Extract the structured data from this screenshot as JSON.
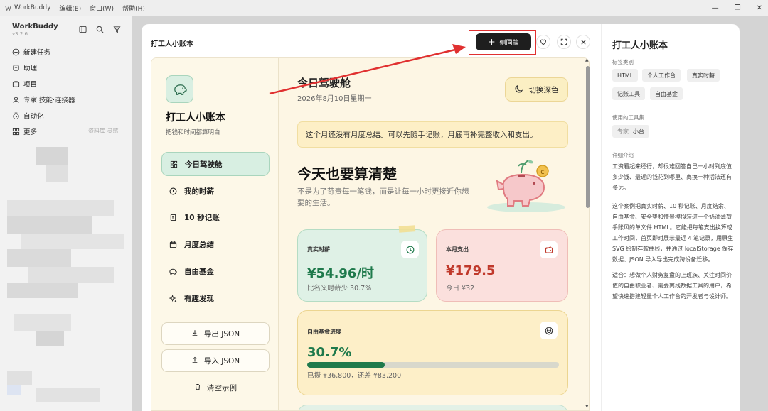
{
  "menubar": {
    "app_name": "WorkBuddy",
    "menus": [
      "编辑(E)",
      "窗口(W)",
      "帮助(H)"
    ]
  },
  "sidebar": {
    "title": "WorkBuddy",
    "version": "v3.2.6",
    "items": [
      {
        "label": "新建任务",
        "icon": "new-task-icon"
      },
      {
        "label": "助理",
        "icon": "assistant-icon"
      },
      {
        "label": "项目",
        "icon": "project-icon"
      },
      {
        "label": "专家·技能·连接器",
        "icon": "expert-icon"
      },
      {
        "label": "自动化",
        "icon": "automation-icon"
      },
      {
        "label": "更多",
        "icon": "more-icon"
      }
    ],
    "more_extra": "资料库 灵感"
  },
  "main": {
    "doc_title": "打工人小账本",
    "side_button_label": "侧同款"
  },
  "preview": {
    "app_title": "打工人小账本",
    "app_subtitle": "把钱和时间都算明白",
    "nav_items": [
      "今日驾驶舱",
      "我的时薪",
      "10 秒记账",
      "月度总结",
      "自由基金",
      "有趣发现"
    ],
    "export_label": "导出 JSON",
    "import_label": "导入 JSON",
    "clear_label": "清空示例",
    "page_title": "今日驾驶舱",
    "date": "2026年8月10日星期一",
    "theme_button": "切换深色",
    "notice": "这个月还没有月度总结。可以先随手记账，月底再补完整收入和支出。",
    "hero_title": "今天也要算清楚",
    "hero_subtitle": "不是为了苛责每一笔钱，而是让每一小时更接近你想要的生活。",
    "cards": {
      "wage": {
        "label": "真实时薪",
        "value": "¥54.96/时",
        "sub": "比名义时薪少 30.7%"
      },
      "expense": {
        "label": "本月支出",
        "value": "¥179.5",
        "sub": "今日 ¥32"
      },
      "fund": {
        "label": "自由基金进度",
        "value": "30.7%",
        "progress": 0.307,
        "sub": "已攒 ¥36,800，还差 ¥83,200"
      }
    }
  },
  "right_panel": {
    "title": "打工人小账本",
    "tags_label": "标签类别",
    "tags": [
      "HTML",
      "个人工作台",
      "真实时薪",
      "记账工具",
      "自由基金"
    ],
    "tools_label": "使用的工具集",
    "tool_prefix": "专家",
    "tool_name": "小台",
    "intro_label": "详细介绍",
    "intro_p1": "工资看起来还行，却很难回答自己一小时到底值多少钱、最近的钱花到哪里、离换一种活法还有多远。",
    "intro_p2": "这个案例把真实时薪、10 秒记账、月度结余、自由基金、安全垫和情景模拟装进一个奶油薄荷手账风的单文件 HTML。它能把每笔支出换算成工作时间，首页即时展示最近 4 笔记录，用原生 SVG 绘制存款曲线，并通过 localStorage 保存数据、JSON 导入导出完成跨设备迁移。",
    "intro_p3": "适合：想做个人财务复盘的上班族、关注时间价值的自由职业者、需要离线数据工具的用户，希望快速搭建轻量个人工作台的开发者与设计师。"
  },
  "colors": {
    "accent_green": "#1f7a4c",
    "accent_red": "#c0392b",
    "annotation_red": "#e03030"
  }
}
